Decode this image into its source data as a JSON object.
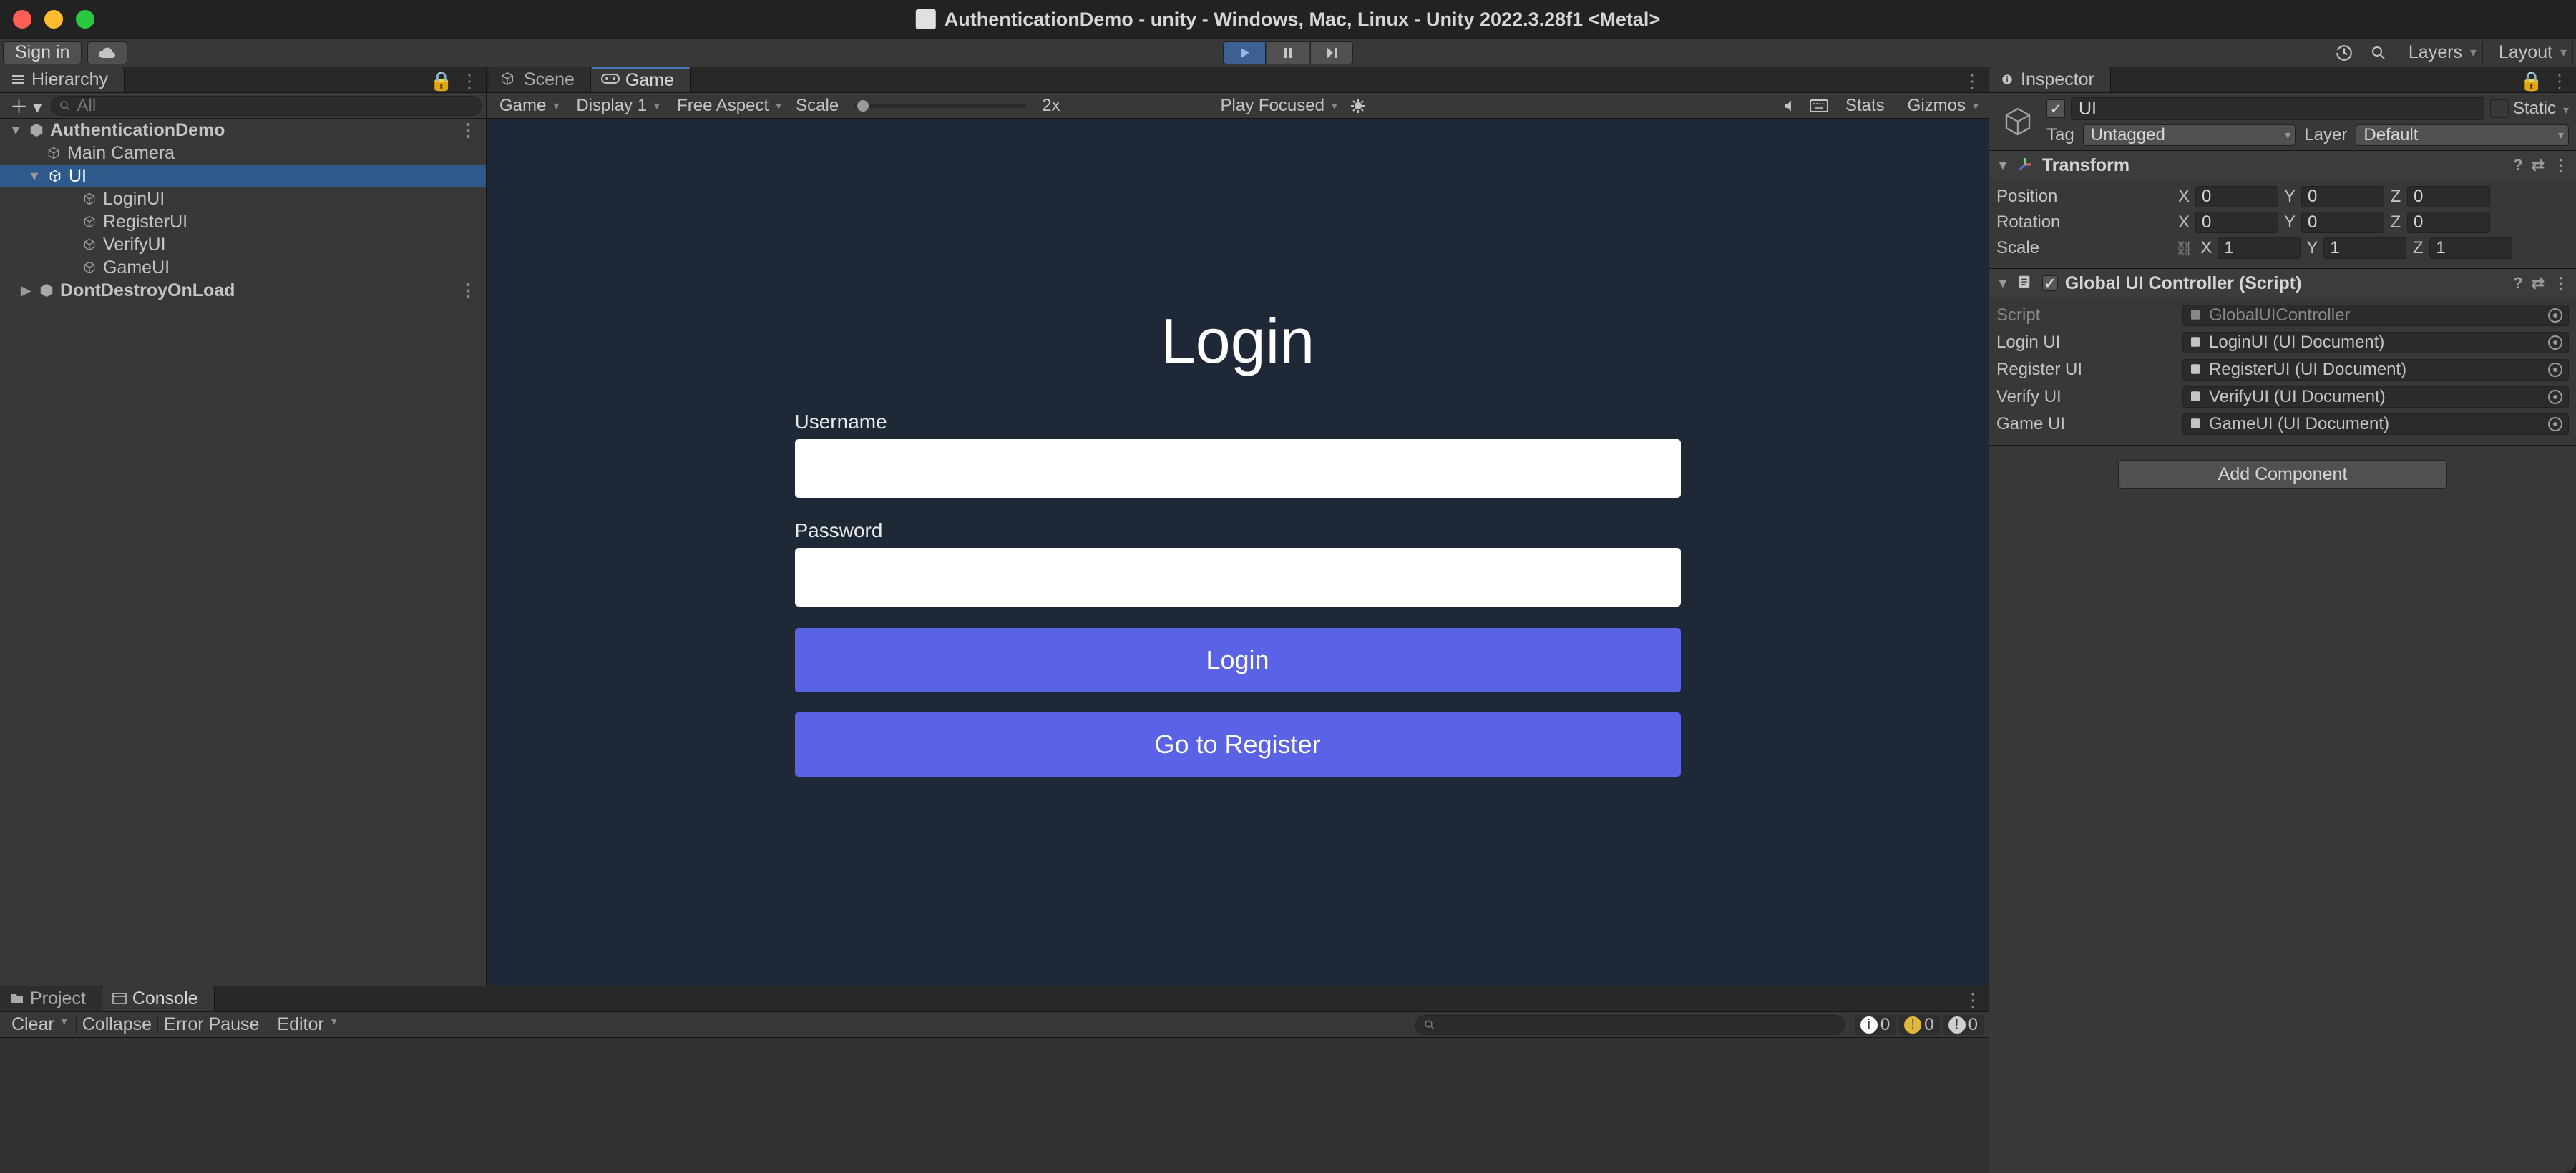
{
  "titlebar": {
    "title": "AuthenticationDemo - unity - Windows, Mac, Linux - Unity 2022.3.28f1 <Metal>"
  },
  "toolbar": {
    "sign_in": "Sign in",
    "layers": "Layers",
    "layout": "Layout"
  },
  "hierarchy": {
    "tab": "Hierarchy",
    "search_placeholder": "All",
    "scene": "AuthenticationDemo",
    "items": [
      "Main Camera",
      "UI",
      "LoginUI",
      "RegisterUI",
      "VerifyUI",
      "GameUI",
      "DontDestroyOnLoad"
    ]
  },
  "mid": {
    "scene_tab": "Scene",
    "game_tab": "Game",
    "game_dropdown": "Game",
    "display": "Display 1",
    "aspect": "Free Aspect",
    "scale_label": "Scale",
    "scale_value": "2x",
    "play_focused": "Play Focused",
    "stats": "Stats",
    "gizmos": "Gizmos"
  },
  "login_ui": {
    "title": "Login",
    "username_label": "Username",
    "password_label": "Password",
    "login_btn": "Login",
    "register_btn": "Go to Register"
  },
  "inspector": {
    "tab": "Inspector",
    "object_name": "UI",
    "static_label": "Static",
    "tag_label": "Tag",
    "tag_value": "Untagged",
    "layer_label": "Layer",
    "layer_value": "Default",
    "transform": {
      "title": "Transform",
      "pos_label": "Position",
      "rot_label": "Rotation",
      "scale_label": "Scale",
      "pos": {
        "x": "0",
        "y": "0",
        "z": "0"
      },
      "rot": {
        "x": "0",
        "y": "0",
        "z": "0"
      },
      "scale": {
        "x": "1",
        "y": "1",
        "z": "1"
      }
    },
    "script_comp": {
      "title": "Global UI Controller (Script)",
      "script_label": "Script",
      "script_value": "GlobalUIController",
      "rows": [
        {
          "label": "Login UI",
          "value": "LoginUI (UI Document)"
        },
        {
          "label": "Register UI",
          "value": "RegisterUI (UI Document)"
        },
        {
          "label": "Verify UI",
          "value": "VerifyUI (UI Document)"
        },
        {
          "label": "Game UI",
          "value": "GameUI (UI Document)"
        }
      ]
    },
    "add_component": "Add Component"
  },
  "bottom": {
    "project_tab": "Project",
    "console_tab": "Console",
    "clear": "Clear",
    "collapse": "Collapse",
    "error_pause": "Error Pause",
    "editor": "Editor",
    "counts": {
      "info": "0",
      "warn": "0",
      "err": "0"
    }
  }
}
